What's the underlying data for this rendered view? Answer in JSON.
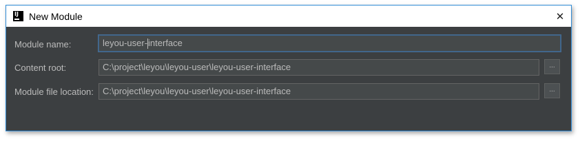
{
  "window": {
    "title": "New Module",
    "app_icon_text": "IJ",
    "close_glyph": "✕"
  },
  "form": {
    "module_name": {
      "label": "Module name:",
      "value_before_caret": "leyou-user-",
      "value_after_caret": "interface"
    },
    "content_root": {
      "label": "Content root:",
      "value": "C:\\project\\leyou\\leyou-user\\leyou-user-interface",
      "browse_label": "..."
    },
    "module_file_location": {
      "label": "Module file location:",
      "value": "C:\\project\\leyou\\leyou-user\\leyou-user-interface",
      "browse_label": "..."
    }
  },
  "colors": {
    "dialog_bg": "#3c3f41",
    "field_bg": "#45494a",
    "focus_border": "#466d94",
    "text": "#bbbbbb",
    "accent_border": "#2f8bd6"
  }
}
